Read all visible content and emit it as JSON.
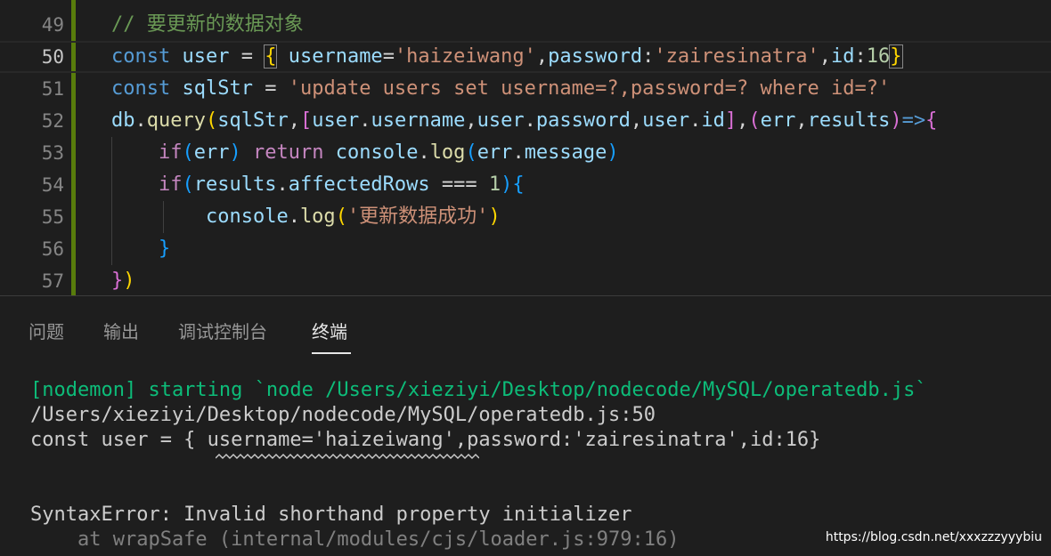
{
  "editor": {
    "line_numbers": [
      "49",
      "50",
      "51",
      "52",
      "53",
      "54",
      "55",
      "56",
      "57"
    ],
    "comment": "// 要更新的数据对象",
    "kw_const": "const",
    "var_user": "user",
    "op_eq": "=",
    "brace_open": "{",
    "brace_close": "}",
    "prop_username": "username",
    "str_haizeiwang": "'haizeiwang'",
    "prop_password": "password",
    "str_password": "'zairesinatra'",
    "prop_id": "id",
    "num_16": "16",
    "var_sqlStr": "sqlStr",
    "str_sql": "'update users set username=?,password=? where id=?'",
    "obj_db": "db",
    "fn_query": "query",
    "arg_sqlStr": "sqlStr",
    "kw_if": "if",
    "var_err": "err",
    "var_results": "results",
    "kw_return": "return",
    "obj_console": "console",
    "fn_log": "log",
    "prop_message": "message",
    "prop_affectedRows": "affectedRows",
    "op_strict_eq": "===",
    "num_1": "1",
    "str_success": "'更新数据成功'"
  },
  "panel": {
    "tabs": [
      "问题",
      "输出",
      "调试控制台",
      "终端"
    ],
    "active_tab": "终端",
    "terminal_lines": [
      "[nodemon] starting `node /Users/xieziyi/Desktop/nodecode/MySQL/operatedb.js`",
      "/Users/xieziyi/Desktop/nodecode/MySQL/operatedb.js:50",
      "const user = { username='haizeiwang',password:'zairesinatra',id:16}",
      "SyntaxError: Invalid shorthand property initializer",
      "    at wrapSafe (internal/modules/cjs/loader.js:979:16)"
    ]
  },
  "watermark": "https://blog.csdn.net/xxxzzzyyybiu"
}
